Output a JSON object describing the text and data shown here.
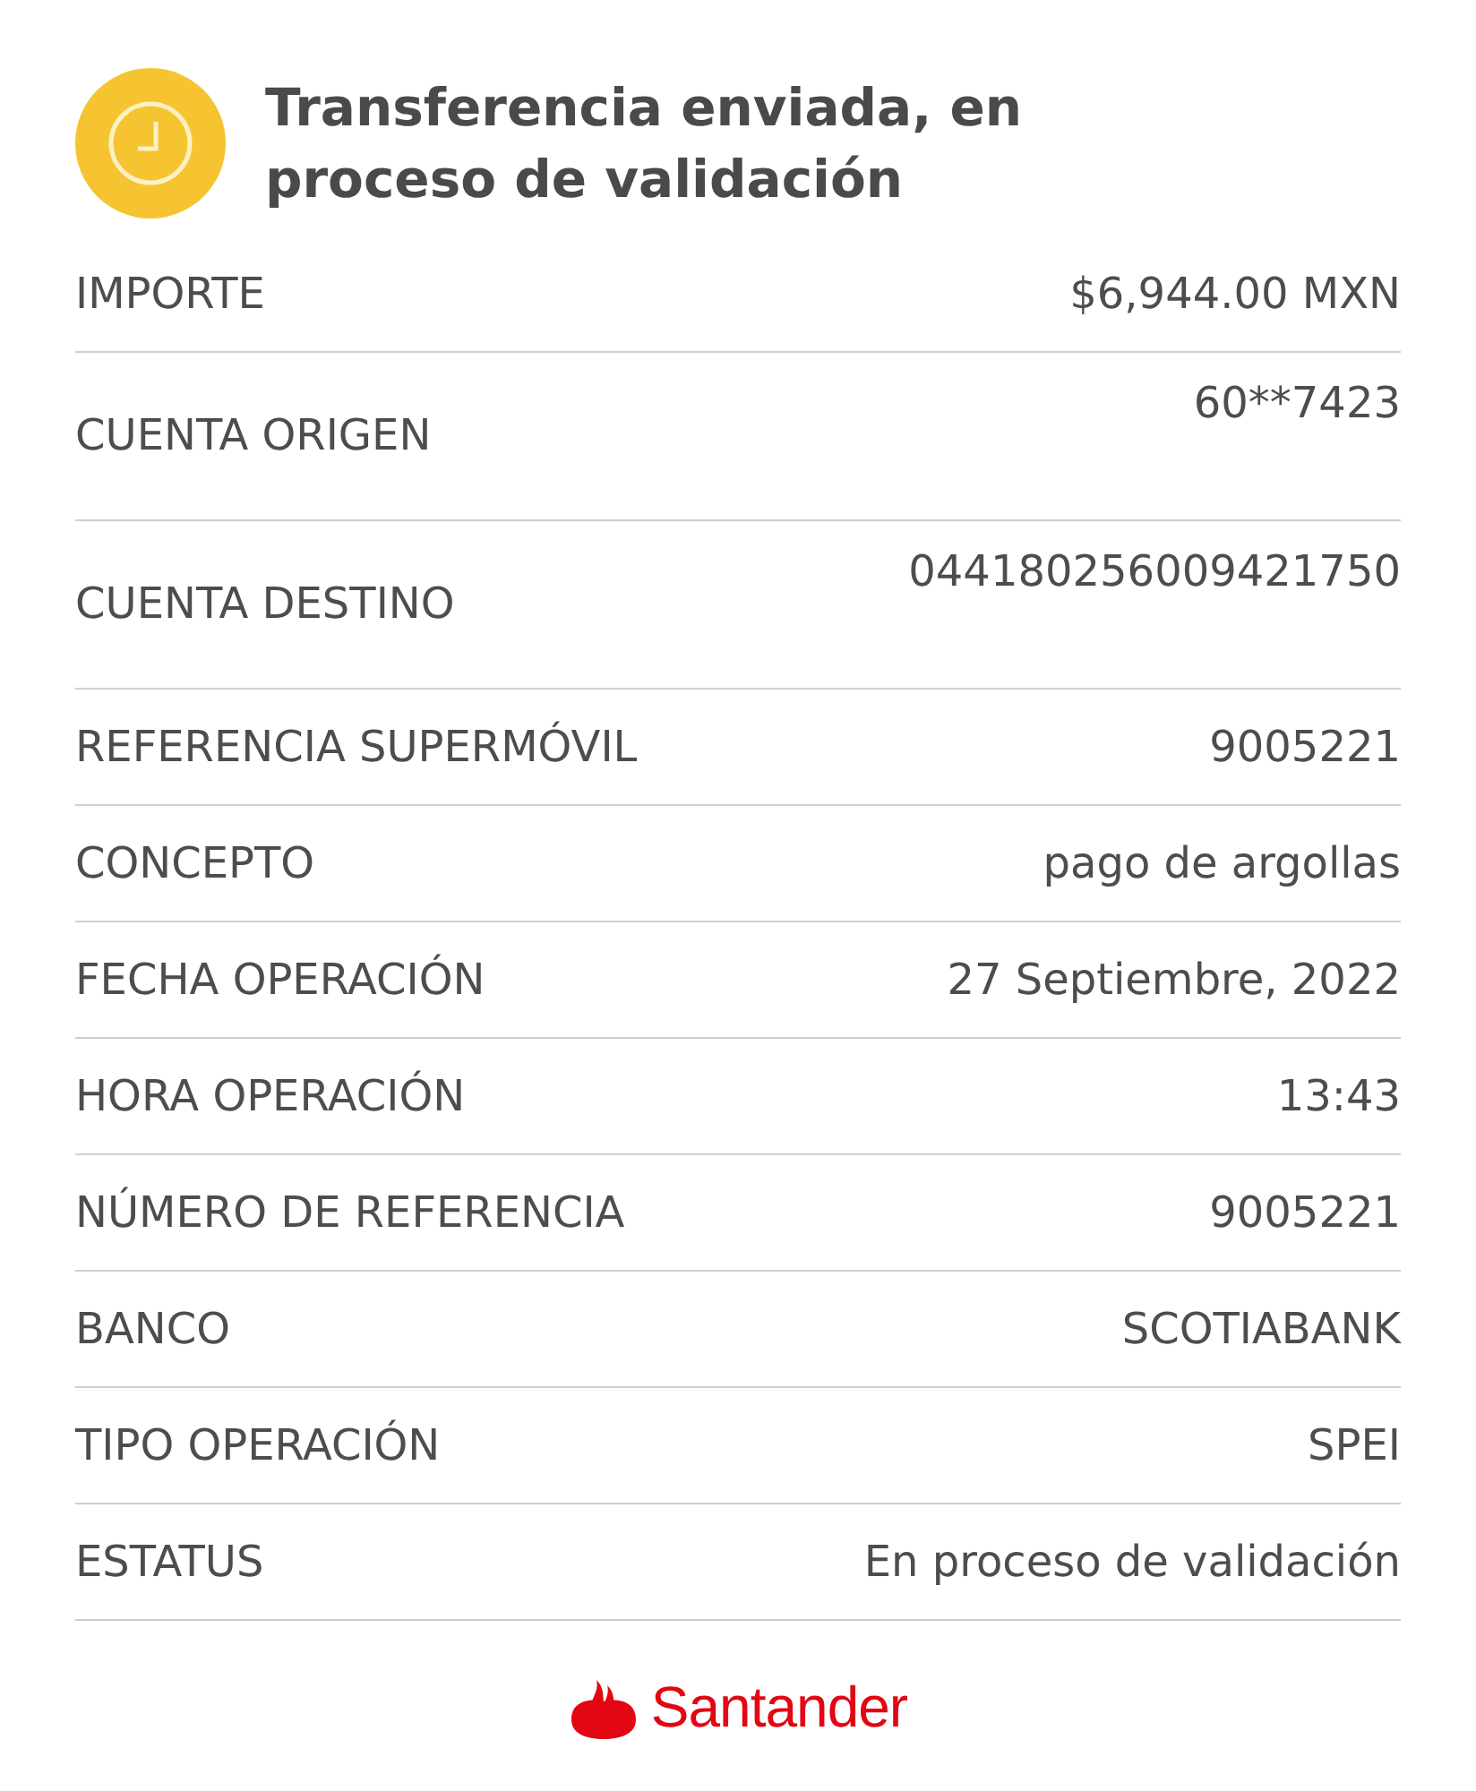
{
  "header": {
    "title": "Transferencia enviada, en proceso de validación"
  },
  "details": [
    {
      "kind": "plain",
      "label": "IMPORTE",
      "value": "$6,944.00 MXN"
    },
    {
      "kind": "account",
      "label": "CUENTA ORIGEN",
      "value": "60**7423"
    },
    {
      "kind": "account",
      "label": "CUENTA DESTINO",
      "value": "044180256009421750"
    },
    {
      "kind": "plain",
      "label": "REFERENCIA SUPERMÓVIL",
      "value": "9005221"
    },
    {
      "kind": "plain",
      "label": "CONCEPTO",
      "value": "pago de argollas"
    },
    {
      "kind": "plain",
      "label": "FECHA OPERACIÓN",
      "value": "27 Septiembre, 2022"
    },
    {
      "kind": "plain",
      "label": "HORA OPERACIÓN",
      "value": "13:43"
    },
    {
      "kind": "plain",
      "label": "NÚMERO DE REFERENCIA",
      "value": "9005221"
    },
    {
      "kind": "plain",
      "label": "BANCO",
      "value": "SCOTIABANK"
    },
    {
      "kind": "plain",
      "label": "TIPO OPERACIÓN",
      "value": "SPEI"
    },
    {
      "kind": "plain",
      "label": "ESTATUS",
      "value": "En proceso de validación"
    }
  ],
  "footer": {
    "brand": "Santander"
  }
}
